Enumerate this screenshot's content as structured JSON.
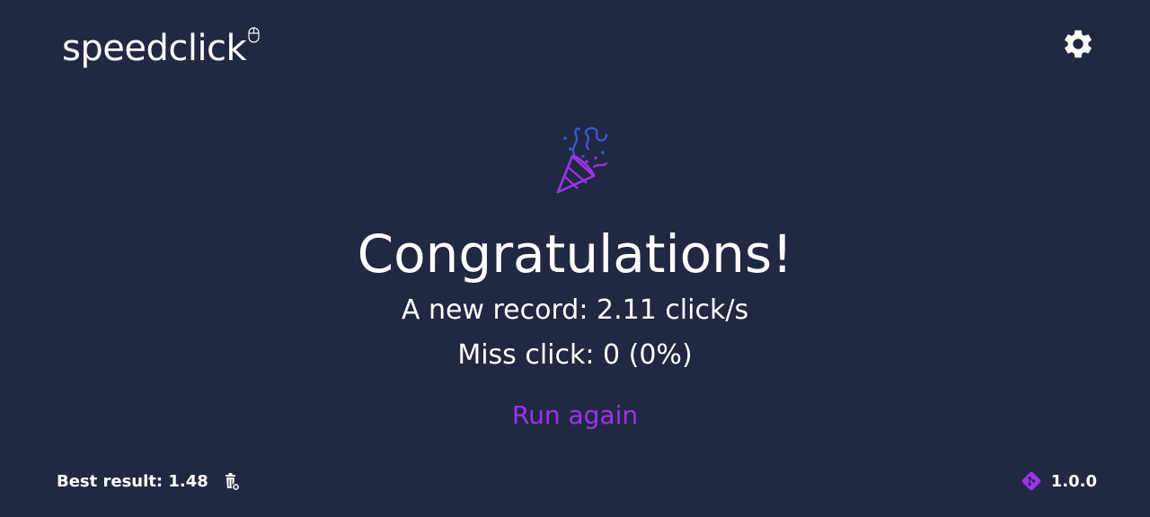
{
  "app": {
    "logo_text": "speedclick"
  },
  "result": {
    "title": "Congratulations!",
    "record_text": "A new record: 2.11 click/s",
    "miss_text": "Miss click: 0 (0%)",
    "run_again_label": "Run again"
  },
  "footer": {
    "best_result_text": "Best result: 1.48",
    "version": "1.0.0"
  },
  "colors": {
    "background": "#212842",
    "accent": "#9b34ea",
    "confetti_blue": "#3b5bdb",
    "text": "#ffffff"
  },
  "icons": [
    "mouse-icon",
    "gear-icon",
    "party-popper-icon",
    "trash-icon",
    "git-icon"
  ]
}
